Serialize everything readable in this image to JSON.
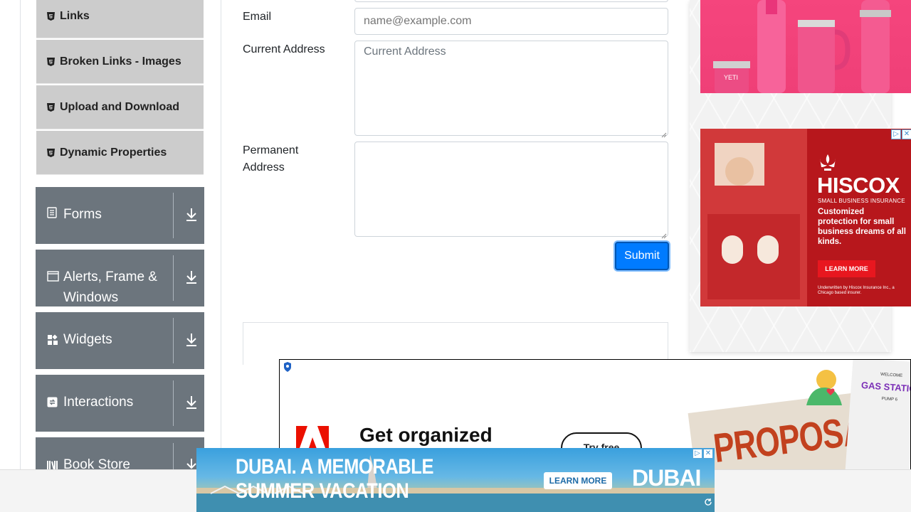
{
  "sidebar": {
    "sub_items": [
      {
        "label": "Links"
      },
      {
        "label": "Broken Links - Images"
      },
      {
        "label": "Upload and Download"
      },
      {
        "label": "Dynamic Properties"
      }
    ],
    "groups": [
      {
        "label": "Forms",
        "icon": "document-icon"
      },
      {
        "label": "Alerts, Frame & Windows",
        "icon": "window-icon"
      },
      {
        "label": "Widgets",
        "icon": "widgets-icon"
      },
      {
        "label": "Interactions",
        "icon": "interactions-icon"
      },
      {
        "label": "Book Store",
        "icon": "books-icon"
      }
    ]
  },
  "form": {
    "email_label": "Email",
    "email_placeholder": "name@example.com",
    "current_address_label": "Current Address",
    "current_address_placeholder": "Current Address",
    "permanent_address_label": "Permanent Address",
    "submit_label": "Submit"
  },
  "ads": {
    "hiscox": {
      "brand": "HISCOX",
      "tagline": "SMALL BUSINESS INSURANCE",
      "body": "Customized protection for small business dreams of all kinds.",
      "cta": "LEARN MORE",
      "fineprint": "Underwritten by Hiscox Insurance Inc., a Chicago based insurer."
    },
    "adobe": {
      "headline": "Get organized",
      "cta": "Try free",
      "proposal": "PROPOSAL",
      "ticket_title": "GAS STATION",
      "ticket_welcome": "WELCOME",
      "ticket_pump": "PUMP 6"
    },
    "yeti": {
      "brand": "YETI"
    },
    "dubai": {
      "headline_line1": "DUBAI. A MEMORABLE",
      "headline_line2": "SUMMER VACATION",
      "cta": "LEARN MORE",
      "logo": "DUBAI"
    }
  },
  "colors": {
    "sidebar_group_bg": "#6c757d",
    "sidebar_sub_bg": "#cccccc",
    "submit_bg": "#007bff",
    "hiscox_red": "#b7171c",
    "yeti_pink": "#f5457d"
  }
}
